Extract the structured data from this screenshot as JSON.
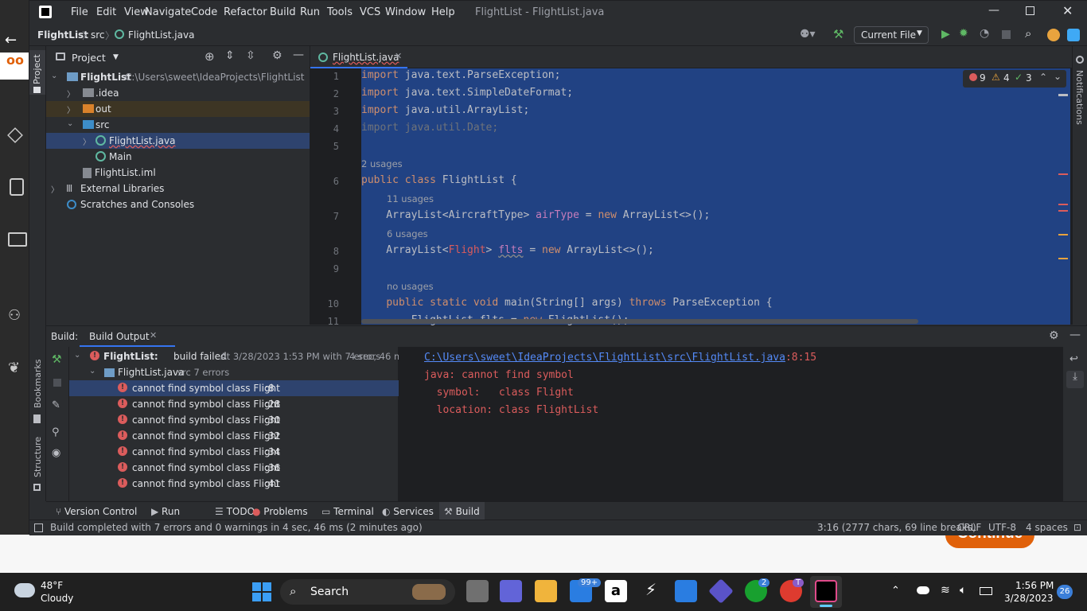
{
  "window": {
    "title": "FlightList - FlightList.java",
    "menu": [
      "File",
      "Edit",
      "View",
      "Navigate",
      "Code",
      "Refactor",
      "Build",
      "Run",
      "Tools",
      "VCS",
      "Window",
      "Help"
    ]
  },
  "breadcrumb": {
    "project": "FlightList",
    "folder": "src",
    "file": "FlightList.java"
  },
  "run_config": "Current File",
  "project_panel": {
    "title": "Project",
    "root": "FlightList",
    "root_path": "C:\\Users\\sweet\\IdeaProjects\\FlightList",
    "items": [
      ".idea",
      "out",
      "src",
      "FlightList.java",
      "Main",
      "FlightList.iml",
      "External Libraries",
      "Scratches and Consoles"
    ]
  },
  "editor": {
    "tab": "FlightList.java",
    "inspections": {
      "errors": "9",
      "warnings": "4",
      "weak": "3"
    },
    "lines": [
      {
        "n": "1",
        "text": "import java.text.ParseException;"
      },
      {
        "n": "2",
        "text": "import java.text.SimpleDateFormat;"
      },
      {
        "n": "3",
        "text": "import java.util.ArrayList;"
      },
      {
        "n": "4",
        "text": "import java.util.Date;"
      },
      {
        "n": "5",
        "text": ""
      },
      {
        "n": "6",
        "hint": "2 usages",
        "text": "public class FlightList {"
      },
      {
        "n": "7",
        "hint": "11 usages",
        "text": "    ArrayList<AircraftType> airType = new ArrayList<>();"
      },
      {
        "n": "8",
        "hint": "6 usages",
        "text": "    ArrayList<Flight> flts = new ArrayList<>();"
      },
      {
        "n": "9",
        "text": ""
      },
      {
        "n": "10",
        "hint": "no usages",
        "text": "    public static void main(String[] args) throws ParseException {"
      },
      {
        "n": "11",
        "text": "        FlightList flts = new FlightList();"
      }
    ]
  },
  "build": {
    "label": "Build:",
    "tab": "Build Output",
    "root": "FlightList:",
    "root_status": "build failed",
    "root_detail": "At 3/28/2023 1:53 PM with 7 errors",
    "root_time": "4 sec, 46 ms",
    "file": "FlightList.java",
    "file_detail": "src 7 errors",
    "errors": [
      {
        "msg": "cannot find symbol class Flight",
        "line": ":8"
      },
      {
        "msg": "cannot find symbol class Flight",
        "line": ":28"
      },
      {
        "msg": "cannot find symbol class Flight",
        "line": ":30"
      },
      {
        "msg": "cannot find symbol class Flight",
        "line": ":32"
      },
      {
        "msg": "cannot find symbol class Flight",
        "line": ":34"
      },
      {
        "msg": "cannot find symbol class Flight",
        "line": ":36"
      },
      {
        "msg": "cannot find symbol class Flight",
        "line": ":41"
      }
    ],
    "output": {
      "path": "C:\\Users\\sweet\\IdeaProjects\\FlightList\\src\\FlightList.java",
      "pos": ":8:15",
      "l1": "java: cannot find symbol",
      "l2": "  symbol:   class Flight",
      "l3": "  location: class FlightList"
    }
  },
  "side_labels": {
    "project": "Project",
    "bookmarks": "Bookmarks",
    "structure": "Structure",
    "notifications": "Notifications"
  },
  "bottom_tabs": [
    "Version Control",
    "Run",
    "TODO",
    "Problems",
    "Terminal",
    "Services",
    "Build"
  ],
  "status": {
    "message": "Build completed with 7 errors and 0 warnings in 4 sec, 46 ms (2 minutes ago)",
    "position": "3:16 (2777 chars, 69 line breaks)",
    "line_sep": "CRLF",
    "encoding": "UTF-8",
    "indent": "4 spaces"
  },
  "background": {
    "continue": "Continue"
  },
  "taskbar": {
    "temp": "48°F",
    "weather": "Cloudy",
    "search": "Search",
    "time": "1:56 PM",
    "date": "3/28/2023",
    "mail_badge": "99+",
    "xbox_badge": "2",
    "chrome_badge": "T",
    "notif_count": "26"
  },
  "colors": {
    "accent": "#3574f0",
    "error": "#db5c5c",
    "selection": "#214283",
    "keyword": "#cf8e6d"
  }
}
